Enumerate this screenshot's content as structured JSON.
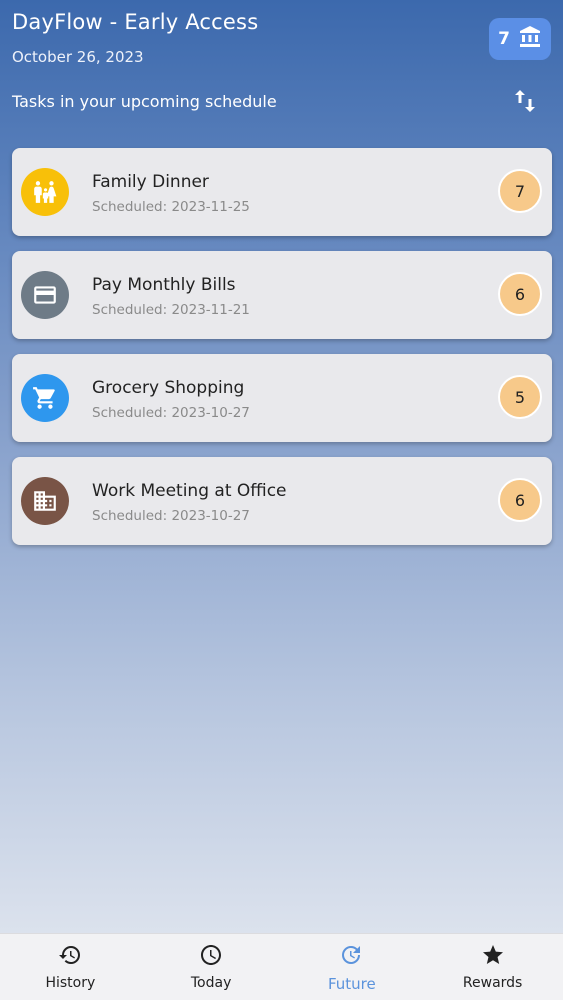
{
  "header": {
    "title": "DayFlow - Early Access",
    "date": "October 26, 2023",
    "points": "7",
    "bank_icon": "bank-icon",
    "section_label": "Tasks in your upcoming schedule",
    "sort_icon": "sort-icon"
  },
  "tasks": [
    {
      "title": "Family Dinner",
      "scheduled": "Scheduled: 2023-11-25",
      "points": "7",
      "icon": "family-icon",
      "color": "#f8c009"
    },
    {
      "title": "Pay Monthly Bills",
      "scheduled": "Scheduled: 2023-11-21",
      "points": "6",
      "icon": "credit-card-icon",
      "color": "#6e7b87"
    },
    {
      "title": "Grocery Shopping",
      "scheduled": "Scheduled: 2023-10-27",
      "points": "5",
      "icon": "shopping-cart-icon",
      "color": "#2e97ee"
    },
    {
      "title": "Work Meeting at Office",
      "scheduled": "Scheduled: 2023-10-27",
      "points": "6",
      "icon": "office-building-icon",
      "color": "#795446"
    }
  ],
  "nav": [
    {
      "label": "History",
      "icon": "history-icon"
    },
    {
      "label": "Today",
      "icon": "clock-icon"
    },
    {
      "label": "Future",
      "icon": "future-icon",
      "active": true
    },
    {
      "label": "Rewards",
      "icon": "star-icon"
    }
  ],
  "colors": {
    "accent": "#5b93dc",
    "badge": "#5b8fe6",
    "points_circle": "#f7c98a"
  }
}
